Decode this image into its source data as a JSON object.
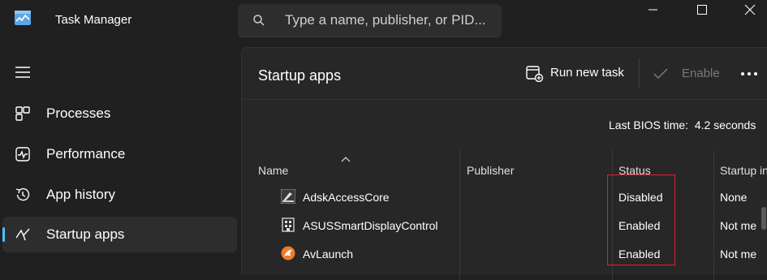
{
  "window": {
    "title": "Task Manager",
    "search_placeholder": "Type a name, publisher, or PID..."
  },
  "sidebar": {
    "items": [
      {
        "label": "Processes",
        "icon": "processes-icon"
      },
      {
        "label": "Performance",
        "icon": "performance-icon"
      },
      {
        "label": "App history",
        "icon": "app-history-icon"
      },
      {
        "label": "Startup apps",
        "icon": "startup-apps-icon",
        "active": true
      }
    ]
  },
  "main": {
    "title": "Startup apps",
    "run_new_task": "Run new task",
    "enable": "Enable",
    "bios_label": "Last BIOS time:",
    "bios_value": "4.2 seconds",
    "columns": {
      "name": "Name",
      "publisher": "Publisher",
      "status": "Status",
      "startup_impact": "Startup in"
    },
    "rows": [
      {
        "name": "AdskAccessCore",
        "publisher": "",
        "status": "Disabled",
        "impact": "None"
      },
      {
        "name": "ASUSSmartDisplayControl",
        "publisher": "",
        "status": "Enabled",
        "impact": "Not me"
      },
      {
        "name": "AvLaunch",
        "publisher": "",
        "status": "Enabled",
        "impact": "Not me"
      }
    ]
  },
  "colors": {
    "accent": "#4cc2ff",
    "highlight": "#d6242c",
    "background": "#202020"
  }
}
